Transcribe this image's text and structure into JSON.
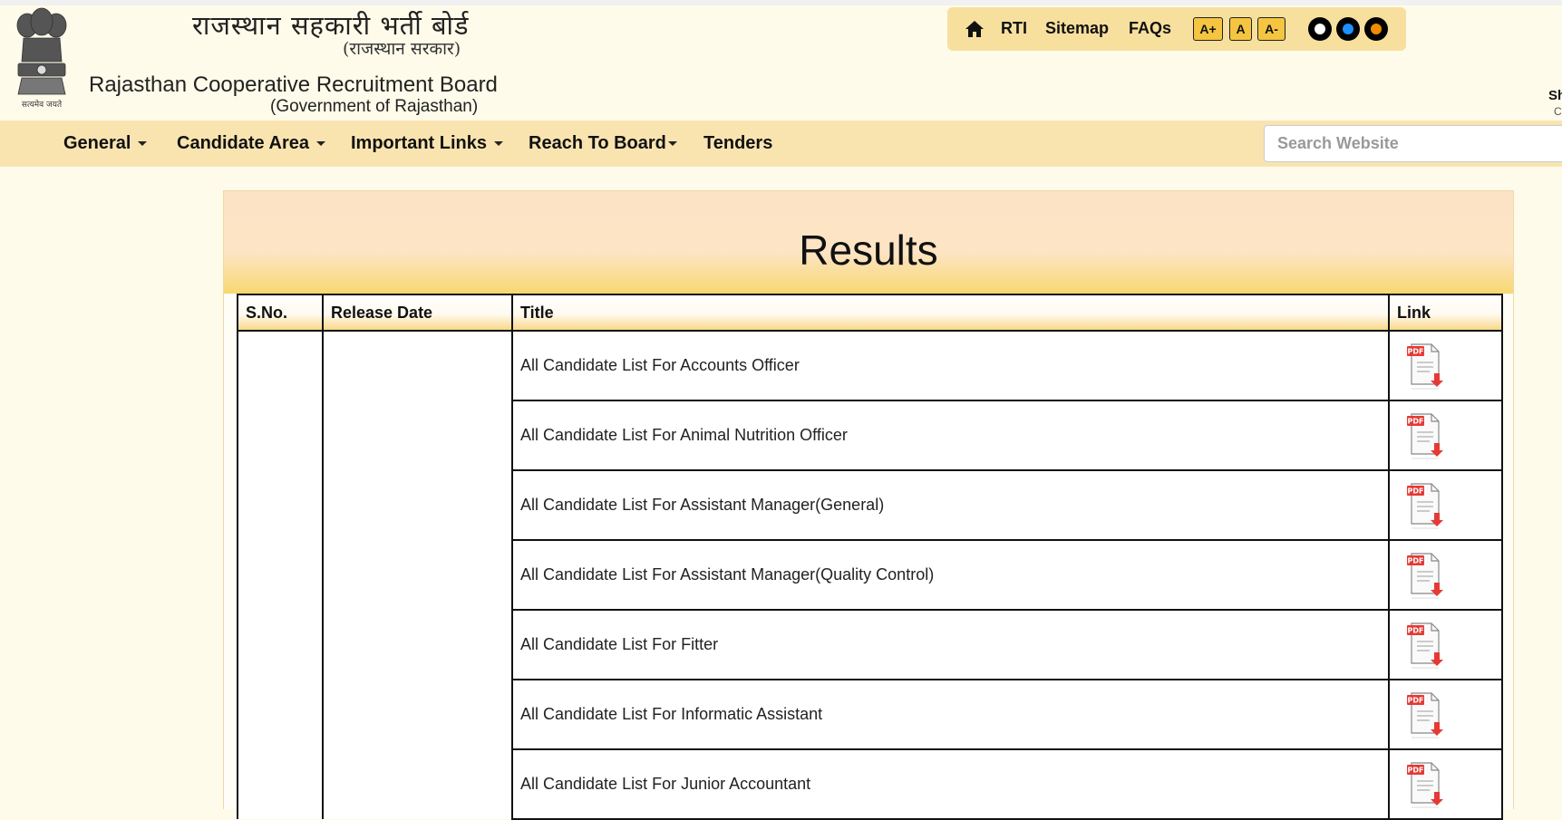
{
  "header": {
    "hindi_title": "राजस्थान सहकारी भर्ती बोर्ड",
    "hindi_subtitle": "(राजस्थान सरकार)",
    "english_title": "Rajasthan Cooperative Recruitment Board",
    "english_subtitle": "(Government of Rajasthan)",
    "emblem_motto": "सत्यमेव जयते",
    "share_text": "Sh",
    "share_sub": "Cl"
  },
  "toolbar": {
    "home_icon": "home-icon",
    "links": [
      "RTI",
      "Sitemap",
      "FAQs"
    ],
    "font_sizes": [
      "A+",
      "A",
      "A-"
    ],
    "themes": [
      {
        "name": "default-theme",
        "color": "#ffffff"
      },
      {
        "name": "blue-theme",
        "color": "#1e90ff"
      },
      {
        "name": "orange-theme",
        "color": "#f08a00"
      }
    ]
  },
  "nav": {
    "items": [
      "General",
      "Candidate Area",
      "Important Links",
      "Reach To Board",
      "Tenders"
    ],
    "search_placeholder": "Search Website"
  },
  "main": {
    "title": "Results",
    "columns": [
      "S.No.",
      "Release Date",
      "Title",
      "Link"
    ],
    "rows": [
      {
        "title": "All Candidate List For Accounts Officer"
      },
      {
        "title": "All Candidate List For Animal Nutrition Officer"
      },
      {
        "title": "All Candidate List For Assistant Manager(General)"
      },
      {
        "title": "All Candidate List For Assistant Manager(Quality Control)"
      },
      {
        "title": "All Candidate List For Fitter"
      },
      {
        "title": "All Candidate List For Informatic Assistant"
      },
      {
        "title": "All Candidate List For Junior Accountant"
      }
    ],
    "pdf_icon": "pdf-download-icon",
    "pdf_label": "PDF"
  },
  "colors": {
    "background": "#fffbea",
    "nav_bar": "#f9e4b0",
    "toolbar": "#f7df9e",
    "accent": "#f5c542",
    "pdf_red": "#e53935"
  }
}
